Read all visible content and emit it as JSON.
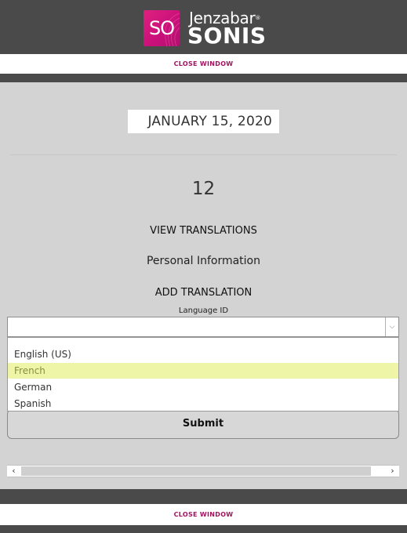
{
  "header": {
    "logo_badge_text": "SO",
    "brand_name": "Jenzabar",
    "brand_tm": "®",
    "product_name": "SONIS"
  },
  "top_close_label": "CLOSE WINDOW",
  "date": "JANUARY 15, 2020",
  "record_number": "12",
  "view_translations_label": "VIEW TRANSLATIONS",
  "section_title": "Personal Information",
  "add_translation_label": "ADD TRANSLATION",
  "language_field": {
    "label": "Language ID",
    "value": "",
    "options": [
      "English (US)",
      "French",
      "German",
      "Spanish"
    ],
    "highlighted": "French"
  },
  "submit_label": "Submit",
  "scrollbar": {
    "left_arrow": "‹",
    "right_arrow": "›"
  },
  "bottom_close_label": "CLOSE WINDOW",
  "colors": {
    "header_bg": "#4a4a4a",
    "page_bg": "#d3d3d3",
    "accent": "#a0145e",
    "logo": "#e0207f",
    "highlight": "#eef5a6"
  }
}
